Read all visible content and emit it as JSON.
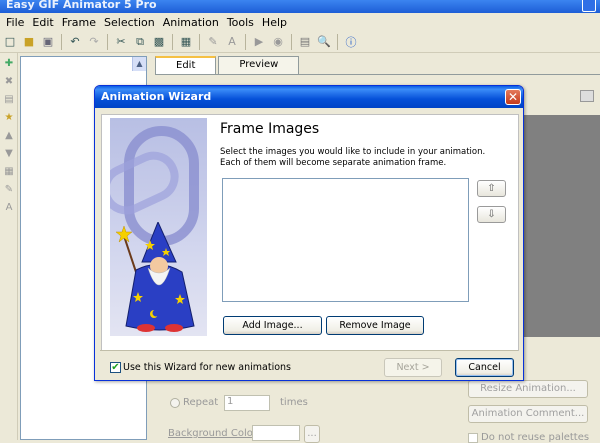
{
  "app": {
    "title": "Easy GIF Animator 5 Pro",
    "menu": [
      "File",
      "Edit",
      "Frame",
      "Selection",
      "Animation",
      "Tools",
      "Help"
    ],
    "tabs": [
      "Edit",
      "Preview"
    ],
    "background": {
      "repeat_label": "Repeat",
      "repeat_value": "1",
      "times_label": "times",
      "bg_color_label": "Background Color:",
      "resize_button": "Resize Animation...",
      "comment_button": "Animation Comment...",
      "reuse_palettes_label": "Do not reuse palettes",
      "browse_button": "..."
    }
  },
  "dialog": {
    "title": "Animation Wizard",
    "heading": "Frame Images",
    "description": "Select the images you would like to include in your animation. Each of them will become separate animation frame.",
    "add_image": "Add Image...",
    "remove_image": "Remove Image",
    "use_wizard_label": "Use this Wizard for new animations",
    "use_wizard_checked": true,
    "next": "Next >",
    "cancel": "Cancel",
    "move_up_icon": "arrow-up-icon",
    "move_down_icon": "arrow-down-icon"
  }
}
